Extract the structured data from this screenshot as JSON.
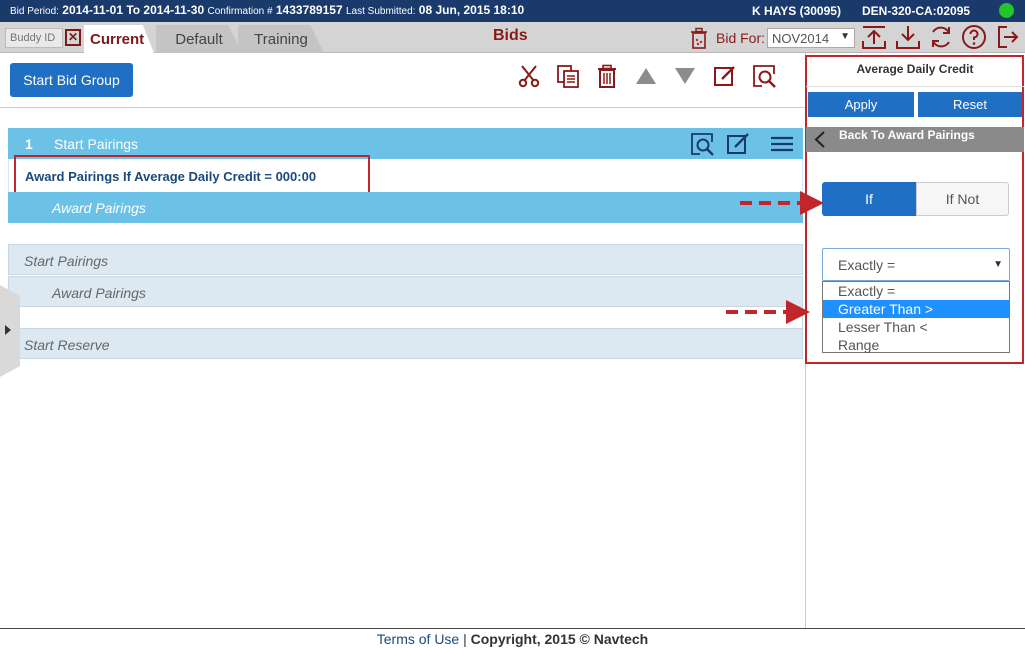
{
  "topbar": {
    "bid_period_label": "Bid Period:",
    "bid_period_value": "2014-11-01 To 2014-11-30",
    "confirmation_label": "Confirmation #",
    "confirmation_value": "1433789157",
    "last_submitted_label": "Last Submitted:",
    "last_submitted_value": "08 Jun, 2015 18:10",
    "user": "K HAYS (30095)",
    "base": "DEN-320-CA:02095",
    "status_color": "#22c62a"
  },
  "tabbar": {
    "buddy_placeholder": "Buddy ID",
    "tabs": [
      {
        "label": "Current"
      },
      {
        "label": "Default"
      },
      {
        "label": "Training"
      }
    ],
    "title": "Bids",
    "bid_for_label": "Bid For:",
    "bid_for_value": "NOV2014",
    "icons": [
      "trash-icon",
      "upload-icon",
      "download-icon",
      "refresh-icon",
      "help-icon",
      "logout-icon"
    ]
  },
  "toolbar": {
    "start_bid_group": "Start Bid Group",
    "icons": [
      "cut-icon",
      "copy-icon",
      "delete-icon",
      "move-up-icon",
      "move-down-icon",
      "edit-icon",
      "preview-icon"
    ]
  },
  "bids": {
    "group1": {
      "number": "1",
      "label": "Start Pairings",
      "award_line": "Award Pairings If Average Daily Credit = 000:00",
      "sub_label": "Award Pairings"
    },
    "rows": [
      {
        "label": "Start Pairings"
      },
      {
        "label": "Award Pairings"
      },
      {
        "label": "Start Reserve"
      }
    ]
  },
  "panel": {
    "title": "Average Daily Credit",
    "apply_label": "Apply",
    "reset_label": "Reset",
    "back_label": "Back To Award Pairings",
    "if_label": "If",
    "if_not_label": "If Not",
    "comparison_value": "Exactly =",
    "options": [
      {
        "label": "Exactly ="
      },
      {
        "label": "Greater Than >"
      },
      {
        "label": "Lesser Than <"
      },
      {
        "label": "Range"
      }
    ],
    "selected_option": "Greater Than >"
  },
  "footer": {
    "terms": "Terms of Use",
    "separator": "|",
    "copyright": "Copyright, 2015 © Navtech"
  },
  "colors": {
    "header_bg": "#1a3a6b",
    "brand_red": "#8a1a1a",
    "accent_blue": "#1f6fc5",
    "row_blue": "#6cc1e6",
    "annotation_red": "#c0262c"
  }
}
